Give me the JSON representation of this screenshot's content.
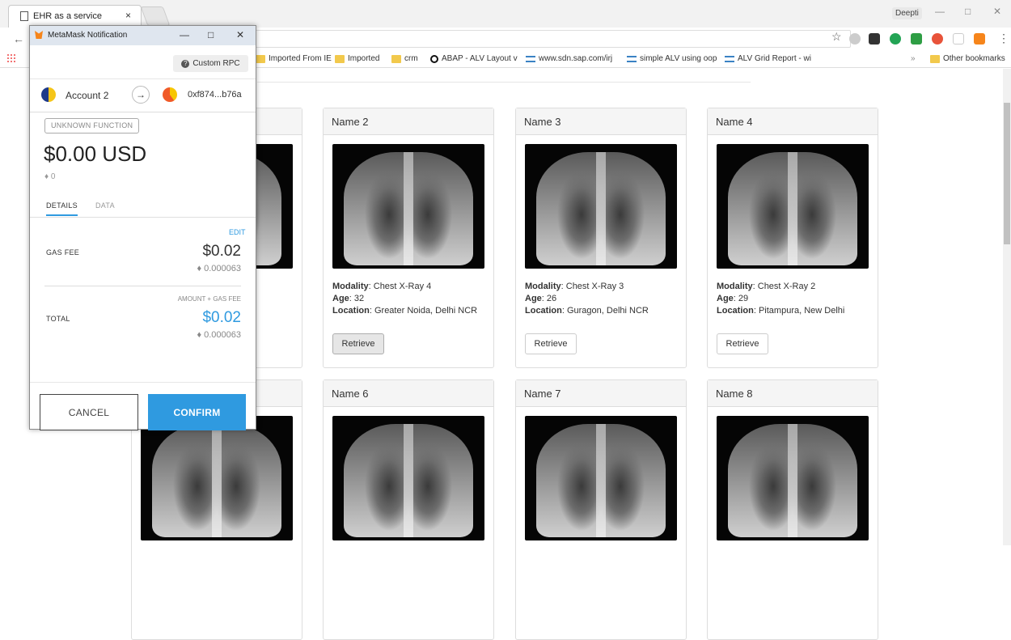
{
  "browser": {
    "tab_title": "EHR as a service",
    "tab_close": "×",
    "profile": "Deepti",
    "win_min": "—",
    "win_max": "□",
    "win_close": "✕",
    "back": "←",
    "star": "☆",
    "menu": "⋮",
    "bookmarks_more": "»",
    "bookmarks": [
      "Imported From IE",
      "Imported",
      "crm",
      "ABAP - ALV Layout v",
      "www.sdn.sap.com/irj",
      "simple ALV using oop",
      "ALV Grid Report - wi",
      "Other bookmarks"
    ]
  },
  "metamask": {
    "window_title": "MetaMask Notification",
    "win_min": "—",
    "win_max": "□",
    "win_close": "✕",
    "network": "Custom RPC",
    "from_account": "Account 2",
    "arrow": "→",
    "to_address": "0xf874...b76a",
    "function_label": "UNKNOWN FUNCTION",
    "amount_usd": "$0.00 USD",
    "amount_eth": "♦ 0",
    "tab_details": "DETAILS",
    "tab_data": "DATA",
    "edit": "EDIT",
    "gas_fee_label": "GAS FEE",
    "gas_fee_usd": "$0.02",
    "gas_fee_eth": "♦ 0.000063",
    "amount_gas_label": "AMOUNT + GAS FEE",
    "total_label": "TOTAL",
    "total_usd": "$0.02",
    "total_eth": "♦ 0.000063",
    "cancel": "CANCEL",
    "confirm": "CONFIRM",
    "accent": "#2f9ae0"
  },
  "page": {
    "field_modality": "Modality",
    "field_age": "Age",
    "field_location": "Location",
    "retrieve_label": "Retrieve",
    "cards": [
      {
        "name": "Name 2",
        "modality": "Chest X-Ray 4",
        "age": "32",
        "location": "Greater Noida, Delhi NCR"
      },
      {
        "name": "Name 3",
        "modality": "Chest X-Ray 3",
        "age": "26",
        "location": "Guragon, Delhi NCR"
      },
      {
        "name": "Name 4",
        "modality": "Chest X-Ray 2",
        "age": "29",
        "location": "Pitampura, New Delhi"
      },
      {
        "name": "Name 6"
      },
      {
        "name": "Name 7"
      },
      {
        "name": "Name 8"
      }
    ]
  }
}
